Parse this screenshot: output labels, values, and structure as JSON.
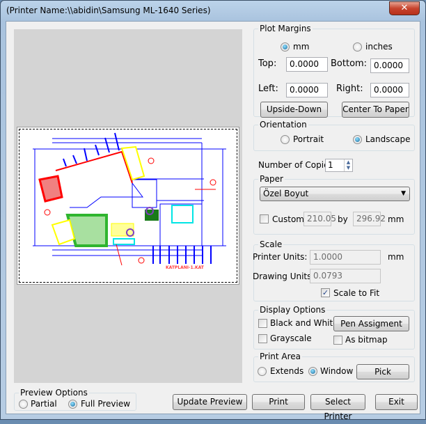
{
  "window": {
    "title": "(Printer Name:\\\\abidin\\Samsung ML-1640 Series)",
    "close_glyph": "✕"
  },
  "preview": {
    "drawing_label": "KATPLANI-1.KAT"
  },
  "plot_margins": {
    "label": "Plot Margins",
    "unit_mm": "mm",
    "unit_inches": "inches",
    "selected_unit": "mm",
    "top_label": "Top:",
    "top": "0.0000",
    "bottom_label": "Bottom:",
    "bottom": "0.0000",
    "left_label": "Left:",
    "left": "0.0000",
    "right_label": "Right:",
    "right": "0.0000",
    "upside_down": "Upside-Down",
    "center_to_paper": "Center To Paper"
  },
  "orientation": {
    "label": "Orientation",
    "portrait": "Portrait",
    "landscape": "Landscape",
    "selected": "Landscape"
  },
  "copies": {
    "label": "Number of Copies :",
    "value": "1"
  },
  "paper": {
    "label": "Paper",
    "selected": "Özel Boyut",
    "custom_label": "Custom",
    "custom_checked": false,
    "width": "210.05",
    "by": "by",
    "height": "296.92",
    "unit": "mm"
  },
  "scale": {
    "label": "Scale",
    "printer_units_label": "Printer Units:",
    "printer_units": "1.0000",
    "unit": "mm",
    "drawing_units_label": "Drawing Units:",
    "drawing_units": "0.0793",
    "scale_to_fit": "Scale to Fit",
    "scale_to_fit_checked": true
  },
  "display_options": {
    "label": "Display Options",
    "black_white": "Black and White",
    "grayscale": "Grayscale",
    "pen_assignment": "Pen Assigment",
    "as_bitmap": "As bitmap"
  },
  "print_area": {
    "label": "Print Area",
    "extends": "Extends",
    "window": "Window",
    "selected": "Window",
    "pick": "Pick"
  },
  "preview_options": {
    "label": "Preview Options",
    "partial": "Partial",
    "full": "Full Preview",
    "selected": "Full Preview"
  },
  "buttons": {
    "update_preview": "Update Preview",
    "print": "Print",
    "select_printer": "Select Printer",
    "exit": "Exit"
  }
}
